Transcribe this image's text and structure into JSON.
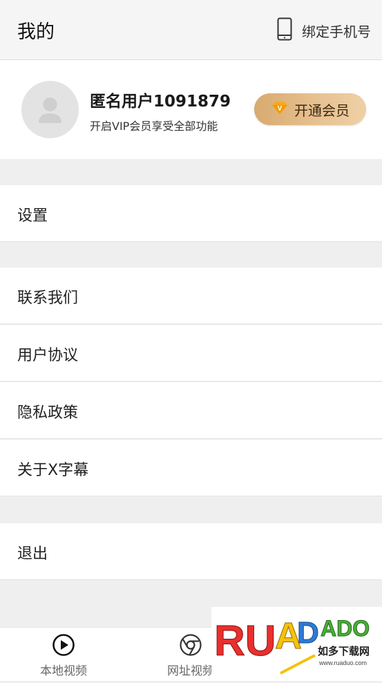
{
  "header": {
    "title": "我的",
    "bind_phone_label": "绑定手机号"
  },
  "profile": {
    "username": "匿名用户1091879",
    "subtitle": "开启VIP会员享受全部功能",
    "vip_button_label": "开通会员",
    "vip_badge": "V"
  },
  "menu": {
    "settings": "设置",
    "contact": "联系我们",
    "user_agreement": "用户协议",
    "privacy": "隐私政策",
    "about": "关于X字幕",
    "logout": "退出"
  },
  "tabs": [
    {
      "label": "本地视频",
      "icon": "play-circle-icon"
    },
    {
      "label": "网址视频",
      "icon": "browser-icon"
    }
  ],
  "watermark": {
    "logo_text": "RUANDADO",
    "site_cn": "如多下载网",
    "url": "www.ruaduo.com"
  },
  "colors": {
    "vip_gold": "#e2b884",
    "watermark_red": "#e8302e",
    "watermark_yellow": "#f4c20d",
    "watermark_blue": "#2e7bd6"
  }
}
